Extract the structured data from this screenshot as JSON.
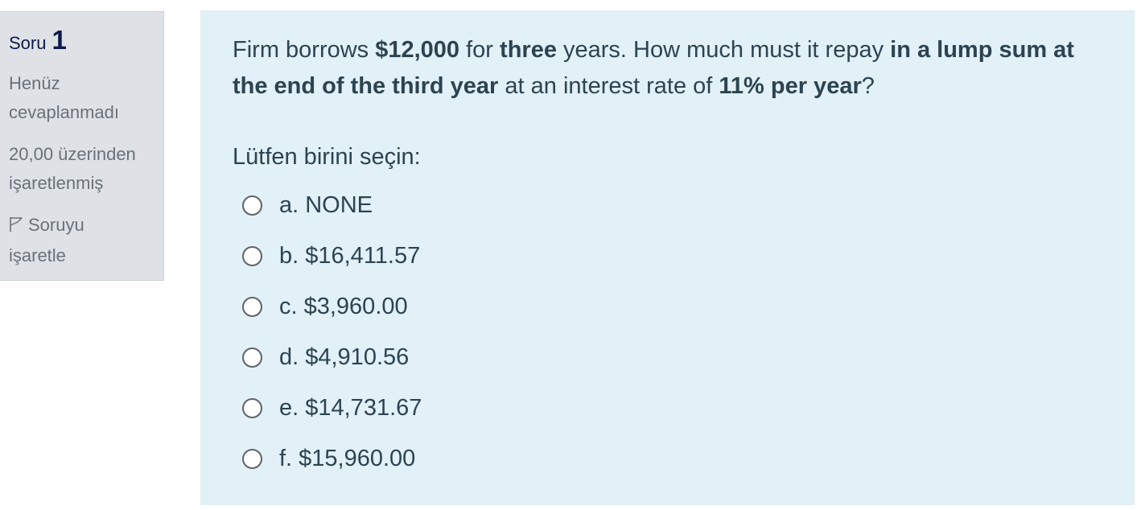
{
  "info": {
    "question_label": "Soru",
    "question_number": "1",
    "state_line1": "Henüz",
    "state_line2": "cevaplanmadı",
    "grade_line1": "20,00 üzerinden",
    "grade_line2": "işaretlenmiş",
    "flag_line1": "Soruyu",
    "flag_line2": "işaretle",
    "flag_icon": "flag-outline-icon"
  },
  "question": {
    "parts": [
      {
        "text": "Firm borrows ",
        "bold": false
      },
      {
        "text": "$12,000",
        "bold": true
      },
      {
        "text": " for ",
        "bold": false
      },
      {
        "text": "three",
        "bold": true
      },
      {
        "text": " years. How much must it repay ",
        "bold": false
      },
      {
        "text": "in a lump sum at the end of the third year",
        "bold": true
      },
      {
        "text": " at an interest rate of ",
        "bold": false
      },
      {
        "text": "11% per year",
        "bold": true
      },
      {
        "text": "?",
        "bold": false
      }
    ],
    "prompt": "Lütfen birini seçin:",
    "options": [
      {
        "label": "a. NONE",
        "selected": false
      },
      {
        "label": "b. $16,411.57",
        "selected": false
      },
      {
        "label": "c. $3,960.00",
        "selected": false
      },
      {
        "label": "d. $4,910.56",
        "selected": false
      },
      {
        "label": "e. $14,731.67",
        "selected": false
      },
      {
        "label": "f. $15,960.00",
        "selected": false
      }
    ]
  },
  "colors": {
    "info_bg": "#dee2e6",
    "content_bg": "#e2f0f7",
    "question_number": "#0f1b4a",
    "text": "#2c4451"
  }
}
